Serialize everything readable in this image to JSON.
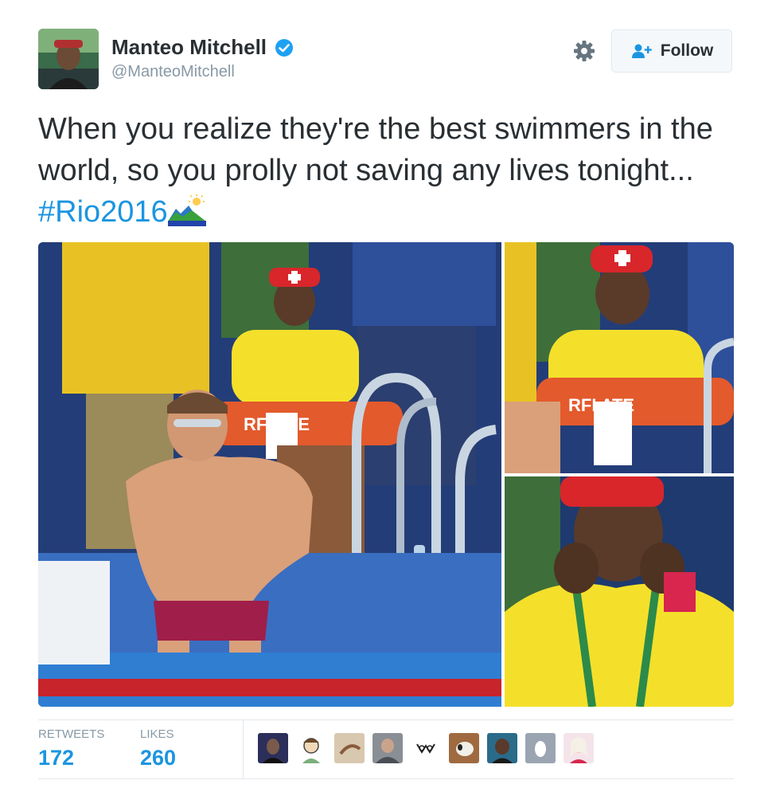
{
  "user": {
    "display_name": "Manteo Mitchell",
    "handle": "@ManteoMitchell",
    "verified": true,
    "verified_icon": "verified-badge-icon",
    "avatar_icon": "profile-photo"
  },
  "actions": {
    "settings_icon": "gear-icon",
    "follow_label": "Follow",
    "follow_icon": "add-user-icon"
  },
  "tweet": {
    "text": "When you realize they're the best swimmers in the world, so you prolly not saving any lives tonight... ",
    "hashtag": "#Rio2016",
    "emoji": "rio-landscape-emoji"
  },
  "media": {
    "photos": [
      {
        "name": "swimmer-and-lifeguard-photo",
        "badge_text": "RFI ATE"
      },
      {
        "name": "lifeguard-closeup-photo",
        "badge_text": "RFI ATE"
      },
      {
        "name": "lifeguard-face-closeup-photo"
      }
    ]
  },
  "stats": {
    "retweets_label": "RETWEETS",
    "retweets_count": "172",
    "likes_label": "LIKES",
    "likes_count": "260"
  },
  "likers": [
    "liker-avatar-1",
    "liker-avatar-2",
    "liker-avatar-3",
    "liker-avatar-4",
    "liker-avatar-5",
    "liker-avatar-6",
    "liker-avatar-7",
    "liker-avatar-8",
    "liker-avatar-9"
  ],
  "colors": {
    "link": "#1b95e0",
    "text": "#292f33",
    "muted": "#8899a6",
    "border": "#e1e8ed",
    "verified": "#1da1f2"
  }
}
